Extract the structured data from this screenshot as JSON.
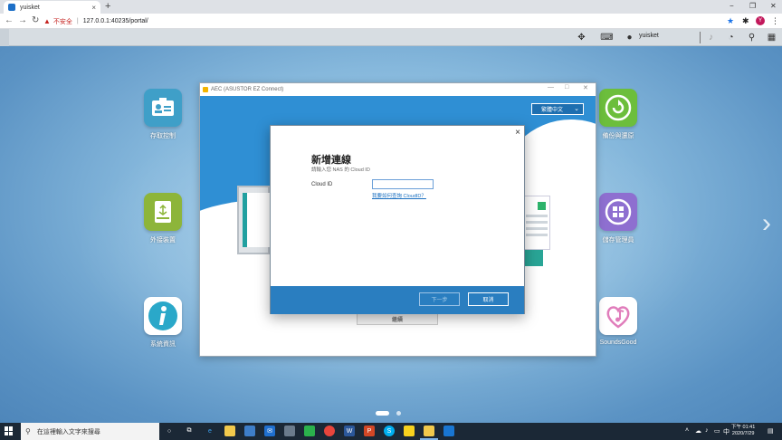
{
  "browser": {
    "tab_title": "yuisket",
    "tab_close": "×",
    "new_tab": "+",
    "win_minimize": "−",
    "win_restore": "❐",
    "win_close": "✕",
    "insecure_label": "不安全",
    "url": "127.0.0.1:40235/portal/",
    "profile_initial": "Y"
  },
  "adm": {
    "username": "yuisket"
  },
  "apps": [
    {
      "label": "存取控制",
      "icon": "access-control-icon",
      "color": "#3f9fc8"
    },
    {
      "label": "外接裝置",
      "icon": "external-device-icon",
      "color": "#8db53a"
    },
    {
      "label": "系統資訊",
      "icon": "system-info-icon",
      "color": "#2aa8c9"
    },
    {
      "label": "備份與還原",
      "icon": "backup-restore-icon",
      "color": "#6cbe3c"
    },
    {
      "label": "儲存管理員",
      "icon": "storage-manager-icon",
      "color": "#8e6fd0"
    },
    {
      "label": "SoundsGood",
      "icon": "soundsgood-icon",
      "color": "#e07dbb"
    }
  ],
  "aec": {
    "window_title": "AEC (ASUSTOR EZ Connect)",
    "language": "繁體中文",
    "bottom_button": "繼續"
  },
  "dialog": {
    "title": "新增連線",
    "subtitle": "請輸入您 NAS 的 Cloud ID",
    "field_label": "Cloud ID",
    "field_value": "",
    "link": "我要如何查詢 CloudID？",
    "next": "下一步",
    "cancel": "取消",
    "close": "×"
  },
  "taskbar": {
    "search_placeholder": "在這裡輸入文字來搜尋",
    "time": "下午 01:41",
    "date": "2020/7/29"
  }
}
